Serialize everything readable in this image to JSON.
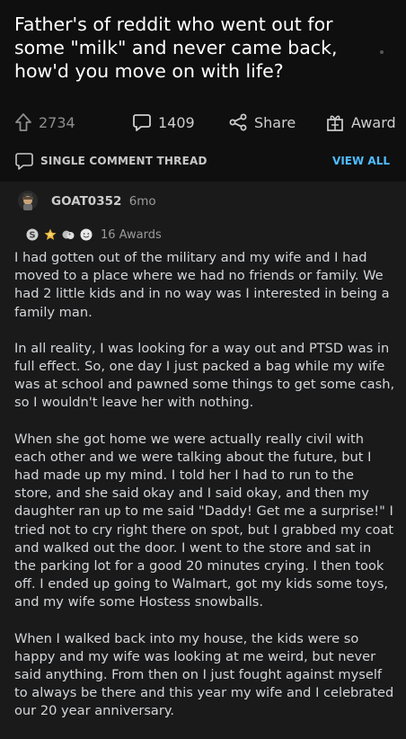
{
  "post": {
    "title": "Father's of reddit who went out for some \"milk\" and never came back, how'd you move on with life?"
  },
  "actions": {
    "upvotes": "2734",
    "comments": "1409",
    "share_label": "Share",
    "award_label": "Award"
  },
  "thread_bar": {
    "label": "SINGLE COMMENT THREAD",
    "view_all": "VIEW ALL"
  },
  "comment": {
    "author": "GOAT0352",
    "age": "6mo",
    "awards_count": "16 Awards",
    "paragraphs": [
      "I had gotten out of the military and my wife and I had moved to a place where we had no friends or family. We had 2 little kids and in no way was I interested in being a family man.",
      "In all reality, I was looking for a way out and PTSD was in full effect. So, one day I just packed a bag while my wife was at school and pawned some things to get some cash, so I wouldn't leave her with nothing.",
      "When she got home we were actually really civil with each other and we were talking about the future, but I had made up my mind. I told her I had to run to the store, and she said okay and I said okay, and then my daughter ran up to me said \"Daddy! Get me a surprise!\" I tried not to cry right there on spot, but I grabbed my coat and walked out the door. I went to the store and sat in the parking lot for a good 20 minutes crying. I then took off. I ended up going to Walmart, got my kids some toys, and my wife some Hostess snowballs.",
      "When I walked back into my house, the kids were so happy and my wife was looking at me weird, but never said anything. From then on I just fought against myself to always be there and this year my wife and I celebrated our 20 year anniversary."
    ]
  },
  "colors": {
    "header_bg": "#0f0f0f",
    "page_bg": "#1a1a1b",
    "link_blue": "#4fbcff"
  }
}
